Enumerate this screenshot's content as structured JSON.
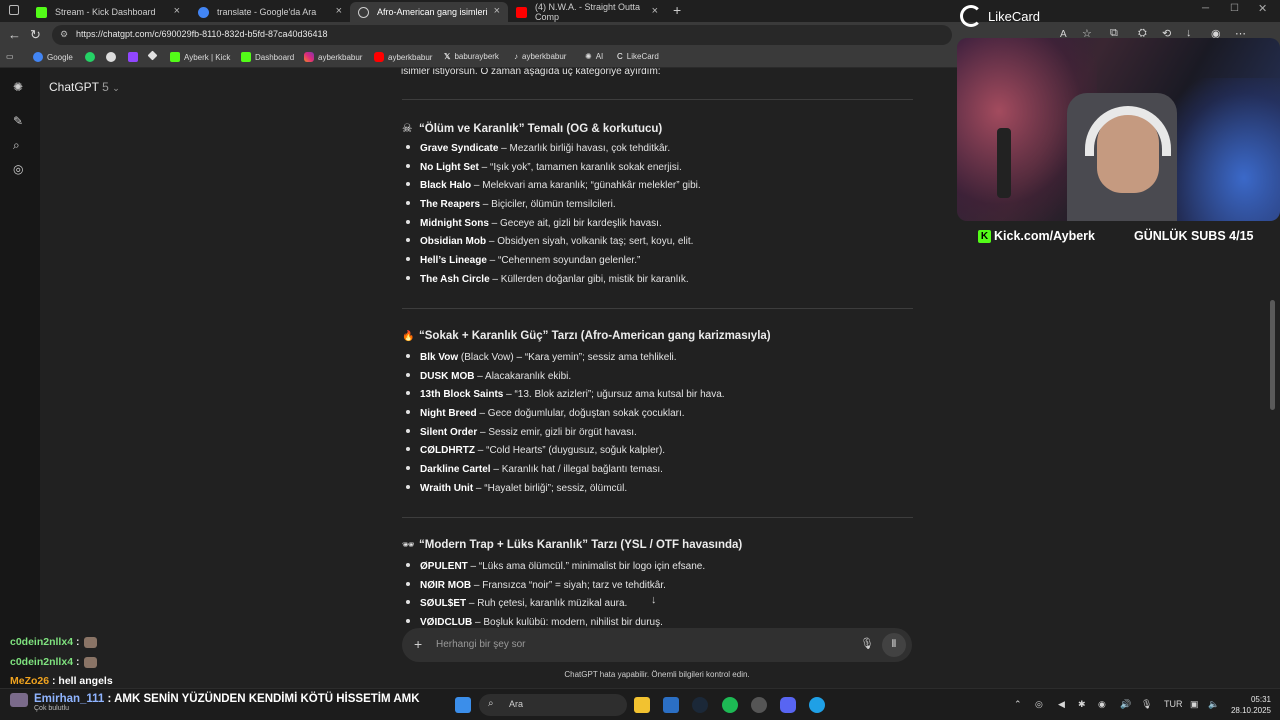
{
  "tabs": [
    {
      "title": "Stream - Kick Dashboard",
      "color": "#53fc18"
    },
    {
      "title": "translate - Google'da Ara",
      "color": "#4285f4"
    },
    {
      "title": "Afro-American gang isimleri",
      "color": "#bbbbbb"
    },
    {
      "title": "(4) N.W.A. - Straight Outta Comp",
      "color": "#ff0000"
    }
  ],
  "url": "https://chatgpt.com/c/690029fb-8110-832d-b5fd-87ca40d36418",
  "bookmarks": [
    "Google",
    "",
    "",
    "",
    "",
    "Ayberk | Kick",
    "Dashboard",
    "ayberkbabur",
    "ayberkbabur",
    "baburayberk",
    "ayberkbabur",
    "AI",
    "LikeCard"
  ],
  "app": {
    "name": "ChatGPT",
    "version": "5"
  },
  "intro_text": "isimler istiyorsun. O zaman aşağıda üç kategoriye ayırdım:",
  "sections": [
    {
      "emoji": "☠",
      "title": "“Ölüm ve Karanlık” Temalı (OG & korkutucu)",
      "items": [
        {
          "name": "Grave Syndicate",
          "desc": " – Mezarlık birliği havası, çok tehditkâr."
        },
        {
          "name": "No Light Set",
          "desc": " – “Işık yok”, tamamen karanlık sokak enerjisi."
        },
        {
          "name": "Black Halo",
          "desc": " – Melekvari ama karanlık; “günahkâr melekler” gibi."
        },
        {
          "name": "The Reapers",
          "desc": " – Biçiciler, ölümün temsilcileri."
        },
        {
          "name": "Midnight Sons",
          "desc": " – Geceye ait, gizli bir kardeşlik havası."
        },
        {
          "name": "Obsidian Mob",
          "desc": " – Obsidyen siyah, volkanik taş; sert, koyu, elit."
        },
        {
          "name": "Hell’s Lineage",
          "desc": " – “Cehennem soyundan gelenler.”"
        },
        {
          "name": "The Ash Circle",
          "desc": " – Küllerden doğanlar gibi, mistik bir karanlık."
        }
      ]
    },
    {
      "emoji": "🔥",
      "title": "“Sokak + Karanlık Güç” Tarzı (Afro-American gang karizmasıyla)",
      "items": [
        {
          "name": "Blk Vow",
          "desc": " (Black Vow) – “Kara yemin”; sessiz ama tehlikeli."
        },
        {
          "name": "DUSK MOB",
          "desc": " – Alacakaranlık ekibi."
        },
        {
          "name": "13th Block Saints",
          "desc": " – “13. Blok azizleri”; uğursuz ama kutsal bir hava."
        },
        {
          "name": "Night Breed",
          "desc": " – Gece doğumlular, doğuştan sokak çocukları."
        },
        {
          "name": "Silent Order",
          "desc": " – Sessiz emir, gizli bir örgüt havası."
        },
        {
          "name": "CØLDHRTZ",
          "desc": " – “Cold Hearts” (duygusuz, soğuk kalpler)."
        },
        {
          "name": "Darkline Cartel",
          "desc": " – Karanlık hat / illegal bağlantı teması."
        },
        {
          "name": "Wraith Unit",
          "desc": " – “Hayalet birliği”; sessiz, ölümcül."
        }
      ]
    },
    {
      "emoji": "🕶",
      "title": "“Modern Trap + Lüks Karanlık” Tarzı (YSL / OTF havasında)",
      "items": [
        {
          "name": "ØPULENT",
          "desc": " – “Lüks ama ölümcül.” minimalist bir logo için efsane."
        },
        {
          "name": "NØIR MOB",
          "desc": " – Fransızca “noir” = siyah; tarz ve tehditkâr."
        },
        {
          "name": "SØUL$ET",
          "desc": " – Ruh çetesi, karanlık müzikal aura."
        },
        {
          "name": "VØIDCLUB",
          "desc": " – Boşluk kulübü: modern, nihilist bir duruş."
        }
      ]
    }
  ],
  "composer": {
    "placeholder": "Herhangi bir şey sor"
  },
  "disclaimer": "ChatGPT hata yapabilir. Önemli bilgileri kontrol edin.",
  "stream": {
    "likecard": "LikeCard",
    "kick_url": "Kick.com/Ayberk",
    "subs": "GÜNLÜK SUBS 4/15",
    "chat": [
      {
        "user": "c0dein2nllx4",
        "msg": " :",
        "color": "#7fe27f"
      },
      {
        "user": "c0dein2nllx4",
        "msg": " :",
        "color": "#7fe27f"
      },
      {
        "user": "MeZo26",
        "msg": " : hell angels",
        "color": "#f0a31f"
      }
    ],
    "banner_user": "Emirhan_111",
    "banner_msg": " : AMK SENİN YÜZÜNDEN KENDİMİ KÖTÜ HİSSETİM AMK"
  },
  "taskbar": {
    "search": "Ara",
    "lang": "TUR",
    "time": "05:31",
    "date": "28.10.2025",
    "weather": "Çok bulutlu"
  }
}
